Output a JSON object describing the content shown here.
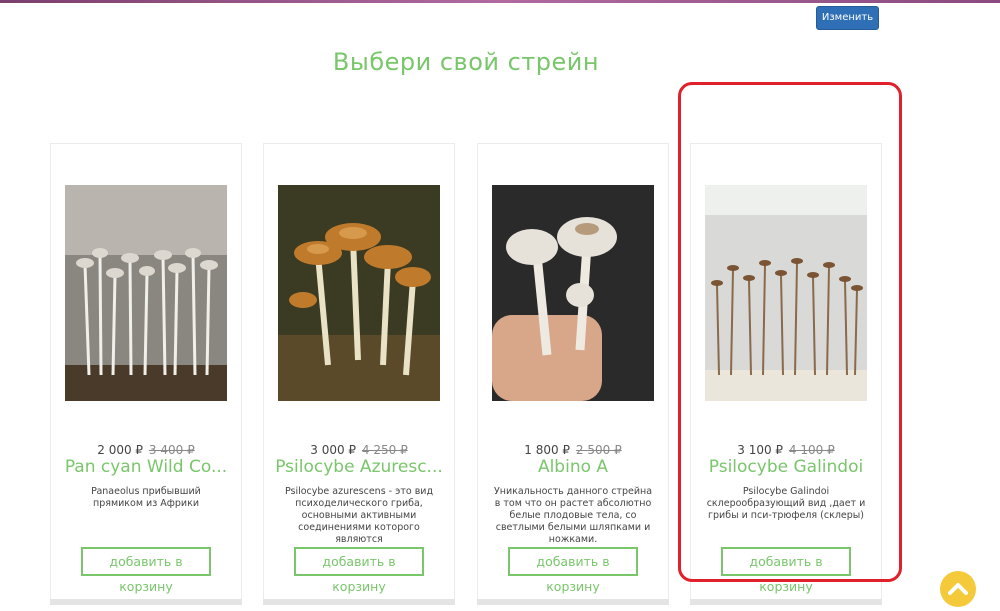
{
  "header": {
    "edit_button_label": "Изменить"
  },
  "section": {
    "title": "Выбери свой стрейн"
  },
  "products": [
    {
      "price": "2 000 ₽",
      "old_price": "3 400 ₽",
      "title": "Pan cyan Wild Co...",
      "description": "Panaeolus прибывший прямиком из Африки",
      "cart_button_label": "добавить в корзину"
    },
    {
      "price": "3 000 ₽",
      "old_price": "4 250 ₽",
      "title": "Psilocybe Azuresc...",
      "description": "Psilocybe azurescens - это вид психоделического гриба, основными активными соединениями которого являются",
      "cart_button_label": "добавить в корзину"
    },
    {
      "price": "1 800 ₽",
      "old_price": "2 500 ₽",
      "title": "Albino A",
      "description": "Уникальность данного стрейна в том что он растет абсолютно белые плодовые тела, со светлыми белыми шляпками и ножками.",
      "cart_button_label": "добавить в корзину"
    },
    {
      "price": "3 100 ₽",
      "old_price": "4 100 ₽",
      "title": "Psilocybe Galindoi",
      "description": "Psilocybe Galindoi склерообразующий вид ,дает и грибы и пси-трюфеля (склеры)",
      "cart_button_label": "добавить в корзину"
    }
  ],
  "colors": {
    "accent_green": "#79c66b",
    "edit_button_blue": "#2f6fb5",
    "highlight_red": "#e0202b",
    "scroll_button_yellow": "#f4c93a"
  },
  "icons": {
    "scroll_top": "chevron-up-icon"
  }
}
